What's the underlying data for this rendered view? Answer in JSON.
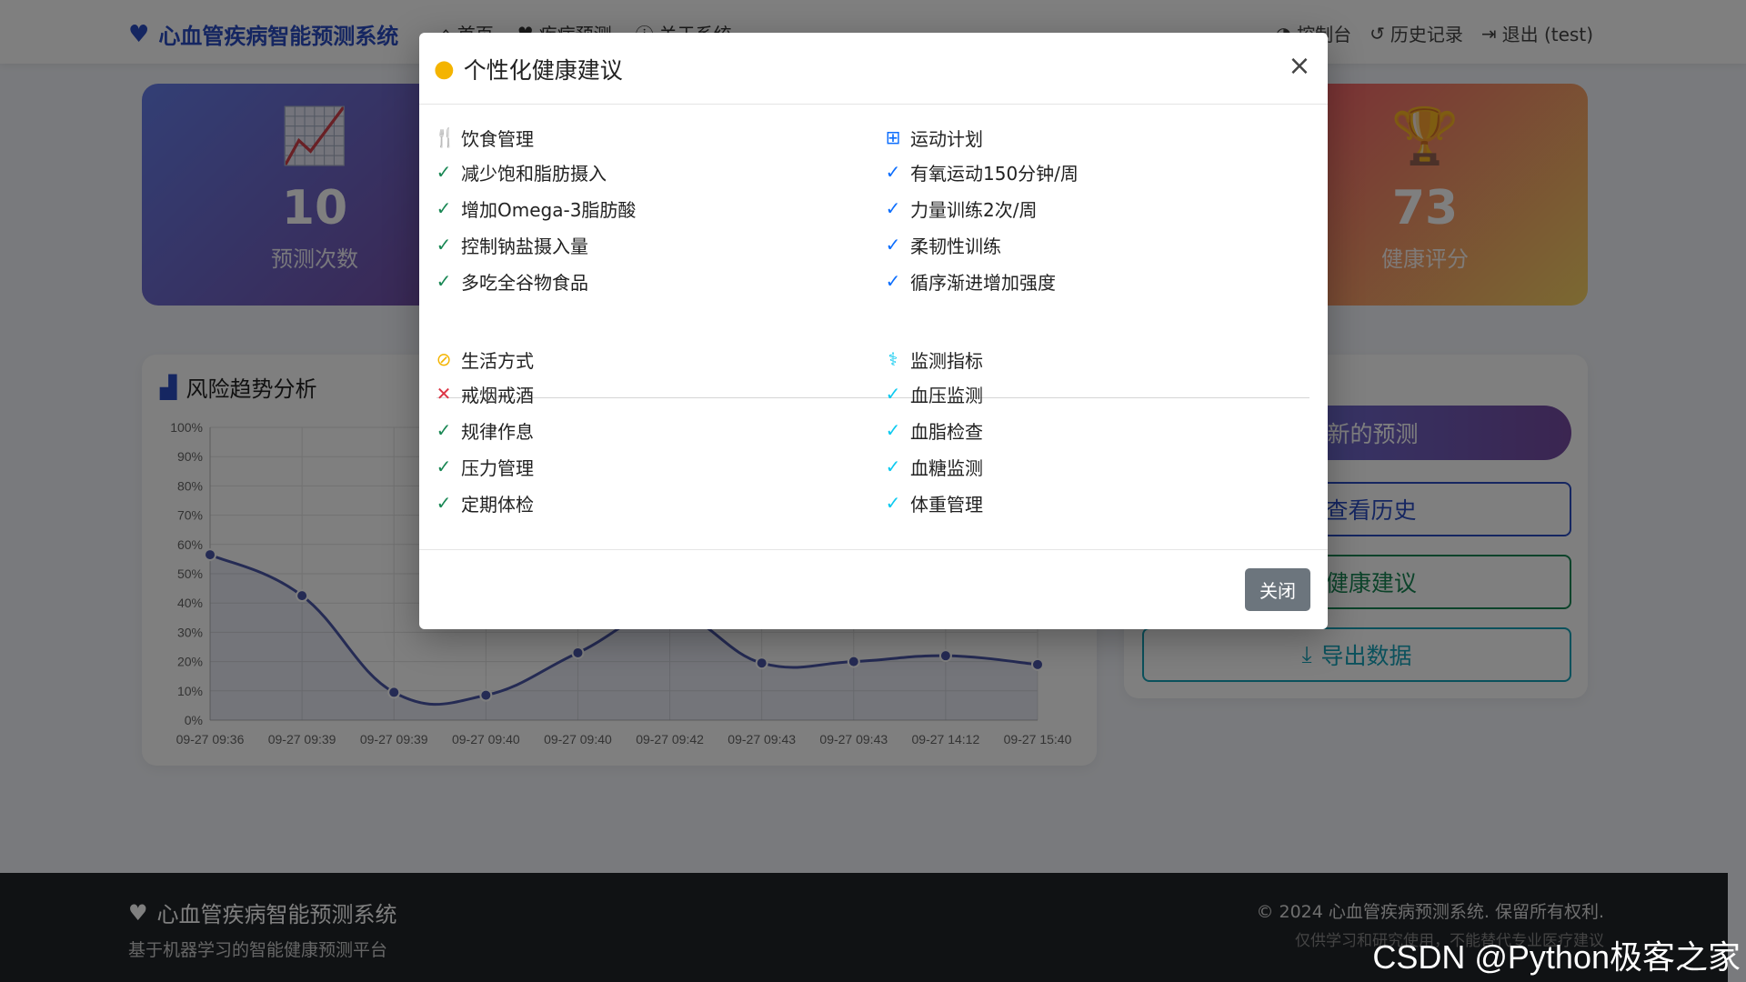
{
  "navbar": {
    "brand": "心血管疾病智能预测系统",
    "links": [
      "首页",
      "疾病预测",
      "关于系统"
    ],
    "right_links": [
      "控制台",
      "历史记录",
      "退出 (test)"
    ]
  },
  "stats": [
    {
      "value": "10",
      "label": "预测次数"
    },
    {
      "value": "73",
      "label": "健康评分"
    }
  ],
  "chart_card": {
    "title": "风险趋势分析"
  },
  "chart_data": {
    "type": "line",
    "x": [
      "09-27 09:36",
      "09-27 09:39",
      "09-27 09:39",
      "09-27 09:40",
      "09-27 09:40",
      "09-27 09:42",
      "09-27 09:43",
      "09-27 09:43",
      "09-27 14:12",
      "09-27 15:40"
    ],
    "series": [
      {
        "values": [
          56.5,
          42.5,
          9.5,
          8.5,
          23,
          37,
          19.5,
          20,
          22,
          19
        ]
      }
    ],
    "ylim": [
      0,
      100
    ],
    "yticks": [
      "0%",
      "10%",
      "20%",
      "30%",
      "40%",
      "50%",
      "60%",
      "70%",
      "80%",
      "90%",
      "100%"
    ],
    "grid": true,
    "color": "#4a57a8"
  },
  "actions": {
    "new_prediction": "新的预测",
    "view_history": "查看历史",
    "health_advice": "健康建议",
    "export": "导出数据"
  },
  "footer": {
    "brand": "心血管疾病智能预测系统",
    "subtitle": "基于机器学习的智能健康预测平台",
    "copyright": "© 2024 心血管疾病预测系统. 保留所有权利.",
    "disclaimer": "仅供学习和研究使用，不能替代专业医疗建议"
  },
  "watermark": "CSDN @Python极客之家",
  "modal": {
    "title": "个性化健康建议",
    "close_button": "关闭",
    "sections": [
      {
        "title": "饮食管理",
        "icon": "utensils-icon",
        "icon_color": "#198754",
        "check_color": "#198754",
        "items": [
          {
            "text": "减少饱和脂肪摄入",
            "status": "check"
          },
          {
            "text": "增加Omega-3脂肪酸",
            "status": "check"
          },
          {
            "text": "控制钠盐摄入量",
            "status": "check"
          },
          {
            "text": "多吃全谷物食品",
            "status": "check"
          }
        ]
      },
      {
        "title": "运动计划",
        "icon": "dumbbell-icon",
        "icon_color": "#0d6efd",
        "check_color": "#0d6efd",
        "items": [
          {
            "text": "有氧运动150分钟/周",
            "status": "check"
          },
          {
            "text": "力量训练2次/周",
            "status": "check"
          },
          {
            "text": "柔韧性训练",
            "status": "check"
          },
          {
            "text": "循序渐进增加强度",
            "status": "check"
          }
        ]
      },
      {
        "title": "生活方式",
        "icon": "ban-smoking-icon",
        "icon_color": "#f4b400",
        "check_color": "#198754",
        "items": [
          {
            "text": "戒烟戒酒",
            "status": "cross"
          },
          {
            "text": "规律作息",
            "status": "check"
          },
          {
            "text": "压力管理",
            "status": "check"
          },
          {
            "text": "定期体检",
            "status": "check"
          }
        ]
      },
      {
        "title": "监测指标",
        "icon": "stethoscope-icon",
        "icon_color": "#0dcaf0",
        "check_color": "#0dcaf0",
        "items": [
          {
            "text": "血压监测",
            "status": "check"
          },
          {
            "text": "血脂检查",
            "status": "check"
          },
          {
            "text": "血糖监测",
            "status": "check"
          },
          {
            "text": "体重管理",
            "status": "check"
          }
        ]
      }
    ]
  }
}
